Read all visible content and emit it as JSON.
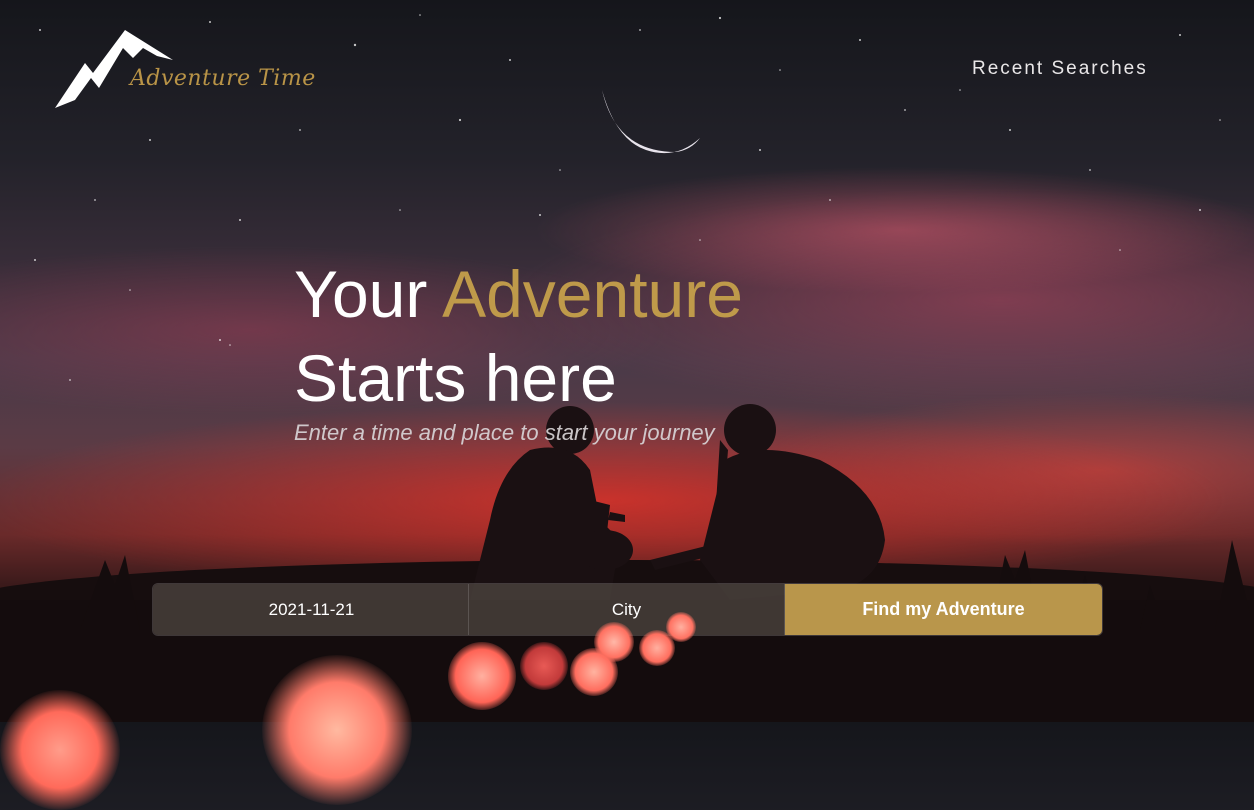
{
  "brand": {
    "name": "Adventure Time",
    "logo_icon": "mountain-icon",
    "accent_color": "#bf9a4a"
  },
  "nav": {
    "recent_searches": "Recent Searches"
  },
  "hero": {
    "title_prefix": "Your ",
    "title_accent": "Adventure",
    "title_line2": "Starts here",
    "subtitle": "Enter a time and place to start your journey"
  },
  "search": {
    "date_value": "2021-11-21",
    "city_placeholder": "City",
    "submit_label": "Find my Adventure",
    "button_color": "#b9964b"
  }
}
